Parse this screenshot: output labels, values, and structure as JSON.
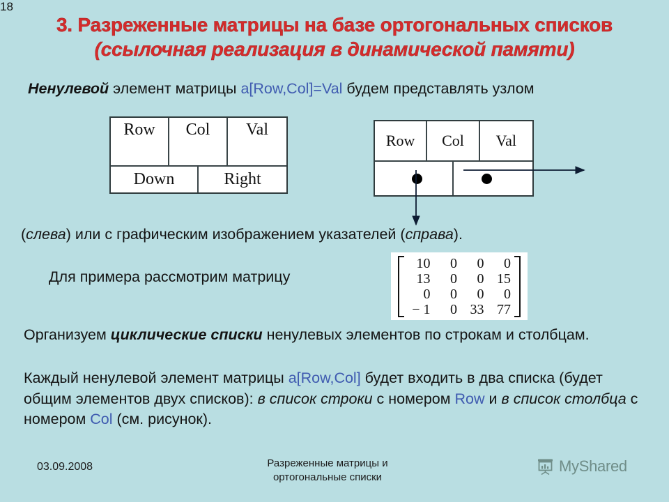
{
  "slide": {
    "background_color": "#b9dee2",
    "title_color": "#d52b2b",
    "accent_blue": "#2c3a93",
    "title": {
      "line1": "3. Разреженные матрицы на базе ортогональных списков",
      "line2": "(ссылочная реализация в динамической памяти)"
    }
  },
  "body": {
    "nonzero": {
      "part1": "Ненулевой",
      "part2": " элемент матрицы ",
      "code": "a[Row,Col]=Val",
      "part3": " будем представлять узлом"
    },
    "left_right": {
      "part1": "(",
      "em1": "слева",
      "part2": ") или с графическим изображением указателей (",
      "em2": "справа",
      "part3": ")."
    },
    "example_label": "Для примера рассмотрим матрицу",
    "cyclic": {
      "part1": "Организуем ",
      "em1": "циклические списки",
      "part2": " ненулевых элементов   по строкам и столбцам."
    },
    "each_element": {
      "part1": "Каждый ненулевой элемент матрицы ",
      "code1": "a[Row,Col]",
      "part2": " будет входить в два списка (будет общим элементов двух списков): ",
      "em1": "в список строки",
      "part3": " с номером ",
      "code2": "Row",
      "part4": " и ",
      "em2": "в список столбца",
      "part5": " с номером ",
      "code3": "Col",
      "part6": " (см. рисунок)."
    }
  },
  "node_left": {
    "caption": "node-structure-fields",
    "top_cells": [
      "Row",
      "Col",
      "Val"
    ],
    "bottom_cells": [
      "Down",
      "Right"
    ]
  },
  "node_right": {
    "caption": "node-structure-pointers",
    "top_cells": [
      "Row",
      "Col",
      "Val"
    ],
    "pointer_down_icon": "filled-dot-icon",
    "pointer_right_icon": "filled-dot-icon"
  },
  "matrix": {
    "rows": [
      [
        "10",
        "0",
        "0",
        "0"
      ],
      [
        "13",
        "0",
        "0",
        "15"
      ],
      [
        "0",
        "0",
        "0",
        "0"
      ],
      [
        "− 1",
        "0",
        "33",
        "77"
      ]
    ]
  },
  "footer": {
    "date": "03.09.2008",
    "subject_line1": "Разреженные матрицы и",
    "subject_line2": "ортогональные списки",
    "watermark": "MyShared",
    "watermark_icon": "presentation-chart-icon",
    "page_number": "18"
  }
}
